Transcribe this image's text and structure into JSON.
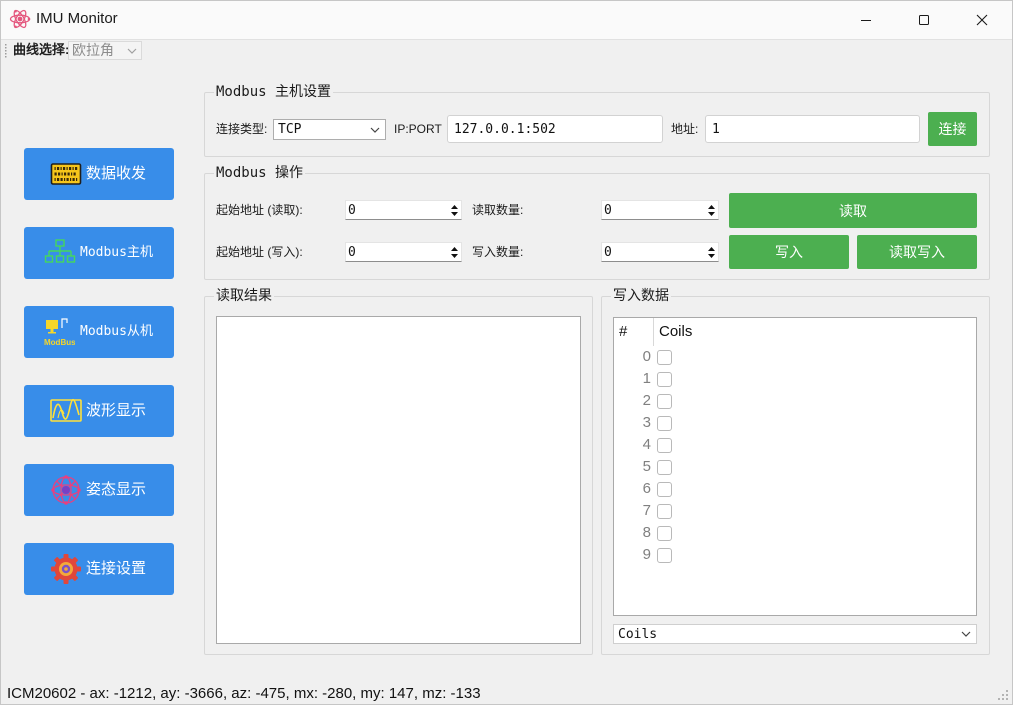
{
  "window": {
    "title": "IMU Monitor",
    "app_icon": "atom-icon",
    "minimize_icon": "minimize-icon",
    "maximize_icon": "maximize-icon",
    "close_icon": "close-icon"
  },
  "toolbar": {
    "curve_label": "曲线选择:",
    "curve_select_value": "欧拉角"
  },
  "sidebar": {
    "items": [
      {
        "label": "数据收发",
        "icon": "binary-board-icon"
      },
      {
        "label": "Modbus主机",
        "icon": "network-tree-icon"
      },
      {
        "label": "Modbus从机",
        "icon": "modbus-device-icon",
        "icon_caption": "ModBus"
      },
      {
        "label": "波形显示",
        "icon": "waveform-icon"
      },
      {
        "label": "姿态显示",
        "icon": "attitude-sphere-icon"
      },
      {
        "label": "连接设置",
        "icon": "gear-icon"
      }
    ]
  },
  "master_settings": {
    "title": "Modbus 主机设置",
    "conn_type": {
      "label": "连接类型:",
      "value": "TCP"
    },
    "ip_port": {
      "label": "IP:PORT",
      "value": "127.0.0.1:502"
    },
    "address": {
      "label": "地址:",
      "value": "1"
    },
    "connect_button": "连接"
  },
  "operations": {
    "title": "Modbus 操作",
    "read_start": {
      "label": "起始地址 (读取):",
      "value": "0"
    },
    "read_count": {
      "label": "读取数量:",
      "value": "0"
    },
    "write_start": {
      "label": "起始地址 (写入):",
      "value": "0"
    },
    "write_count": {
      "label": "写入数量:",
      "value": "0"
    },
    "read_button": "读取",
    "write_button": "写入",
    "read_write_button": "读取写入"
  },
  "read_result": {
    "title": "读取结果"
  },
  "write_data": {
    "title": "写入数据",
    "header": {
      "index": "#",
      "value": "Coils"
    },
    "rows": [
      {
        "index": "0",
        "checked": false
      },
      {
        "index": "1",
        "checked": false
      },
      {
        "index": "2",
        "checked": false
      },
      {
        "index": "3",
        "checked": false
      },
      {
        "index": "4",
        "checked": false
      },
      {
        "index": "5",
        "checked": false
      },
      {
        "index": "6",
        "checked": false
      },
      {
        "index": "7",
        "checked": false
      },
      {
        "index": "8",
        "checked": false
      },
      {
        "index": "9",
        "checked": false
      }
    ],
    "type_select_value": "Coils"
  },
  "status_bar": {
    "text": "ICM20602 - ax: -1212, ay: -3666, az: -475, mx: -280, my: 147, mz: -133"
  },
  "colors": {
    "sidebar_button": "#388de9",
    "action_button": "#4caf50",
    "window_background": "#f0f0f0"
  }
}
